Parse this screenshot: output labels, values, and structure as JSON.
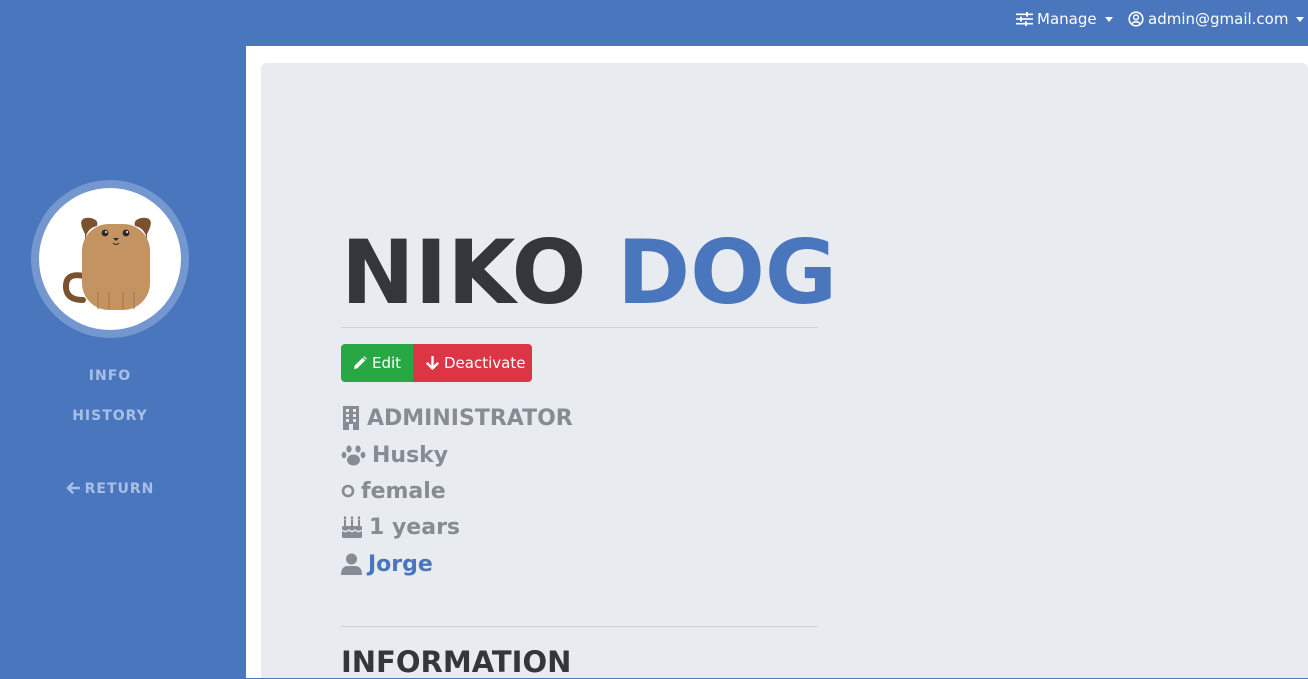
{
  "navbar": {
    "manage_label": "Manage",
    "user_email": "admin@gmail.com"
  },
  "sidebar": {
    "info_label": "INFO",
    "history_label": "HISTORY",
    "return_label": "RETURN"
  },
  "pet": {
    "first_name": "NIKO",
    "last_name": "DOG",
    "role": "ADMINISTRATOR",
    "breed": "Husky",
    "gender": "female",
    "age": "1 years",
    "owner": "Jorge"
  },
  "actions": {
    "edit_label": "Edit",
    "deactivate_label": "Deactivate"
  },
  "sections": {
    "information_title": "INFORMATION"
  },
  "colors": {
    "primary": "#4a76bd",
    "success": "#28a745",
    "danger": "#dc3545",
    "panel": "#e8ebef",
    "muted_text": "#868c93"
  }
}
